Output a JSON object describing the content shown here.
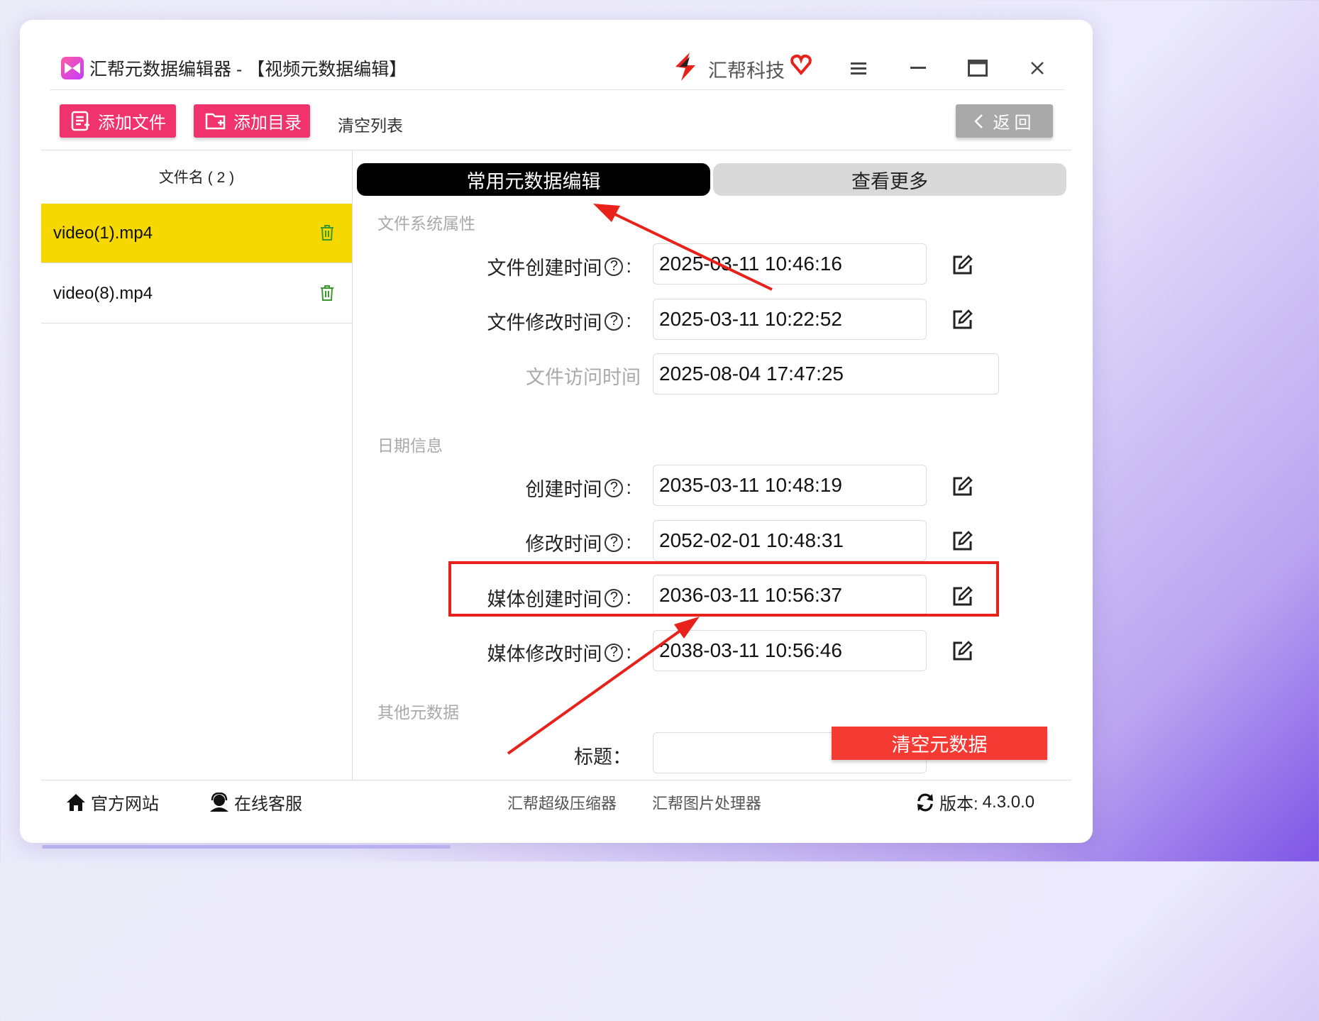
{
  "window": {
    "title": "汇帮元数据编辑器 - 【视频元数据编辑】",
    "brand_name": "汇帮科技",
    "controls": [
      "menu-icon",
      "minimize-icon",
      "maximize-icon",
      "close-icon"
    ]
  },
  "toolbar": {
    "add_file": "添加文件",
    "add_dir": "添加目录",
    "clear_list": "清空列表",
    "back": "返回"
  },
  "file_list": {
    "header": "文件名 ( 2 )",
    "items": [
      {
        "name": "video(1).mp4",
        "selected": true
      },
      {
        "name": "video(8).mp4",
        "selected": false
      }
    ]
  },
  "tabs": {
    "active": "常用元数据编辑",
    "more": "查看更多"
  },
  "sections": {
    "fs": {
      "title": "文件系统属性",
      "fields": [
        {
          "label": "文件创建时间",
          "value": "2025-03-11 10:46:16"
        },
        {
          "label": "文件修改时间",
          "value": "2025-03-11 10:22:52"
        },
        {
          "label": "文件访问时间",
          "value": "2025-08-04 17:47:25"
        }
      ]
    },
    "date": {
      "title": "日期信息",
      "fields": [
        {
          "label": "创建时间",
          "value": "2035-03-11 10:48:19"
        },
        {
          "label": "修改时间",
          "value": "2052-02-01 10:48:31"
        },
        {
          "label": "媒体创建时间",
          "value": "2036-03-11 10:56:37"
        },
        {
          "label": "媒体修改时间",
          "value": "2038-03-11 10:56:46"
        }
      ]
    },
    "other": {
      "title": "其他元数据",
      "fields": [
        {
          "label": "标题：",
          "value": ""
        }
      ]
    }
  },
  "clear_metadata": "清空元数据",
  "footer": {
    "website": "官方网站",
    "support": "在线客服",
    "compressor": "汇帮超级压缩器",
    "image_tool": "汇帮图片处理器",
    "version_label": "版本:",
    "version": "4.3.0.0"
  },
  "colors": {
    "accent_pink": "#f0336c",
    "selected_row": "#f5d800",
    "clear_button": "#f43a32",
    "annotation_red": "#e8211b"
  }
}
